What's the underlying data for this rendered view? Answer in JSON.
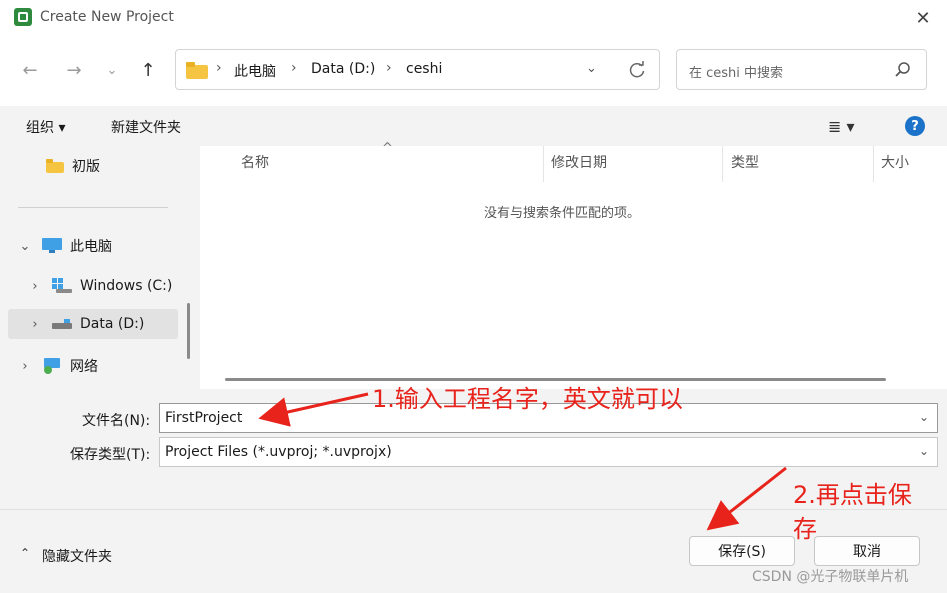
{
  "window": {
    "title": "Create New Project",
    "close_label": "✕"
  },
  "nav": {
    "breadcrumb": [
      "此电脑",
      "Data (D:)",
      "ceshi"
    ],
    "search_placeholder": "在 ceshi 中搜索"
  },
  "toolbar": {
    "organize_label": "组织 ▾",
    "new_folder_label": "新建文件夹"
  },
  "sidebar": {
    "items": [
      {
        "label": "初版"
      },
      {
        "label": "此电脑"
      },
      {
        "label": "Windows (C:)"
      },
      {
        "label": "Data (D:)"
      },
      {
        "label": "网络"
      }
    ]
  },
  "filelist": {
    "columns": [
      "名称",
      "修改日期",
      "类型",
      "大小"
    ],
    "empty_message": "没有与搜索条件匹配的项。"
  },
  "form": {
    "filename_label": "文件名(N):",
    "filename_value": "FirstProject",
    "filetype_label": "保存类型(T):",
    "filetype_value": "Project Files (*.uvproj; *.uvprojx)"
  },
  "footer": {
    "hide_folders_label": "隐藏文件夹",
    "save_label": "保存(S)",
    "cancel_label": "取消"
  },
  "annotations": {
    "step1": "1.输入工程名字，英文就可以",
    "step2_line1": "2.再点击保",
    "step2_line2": "存",
    "color": "#e8231b"
  },
  "watermark": "CSDN @光子物联单片机"
}
